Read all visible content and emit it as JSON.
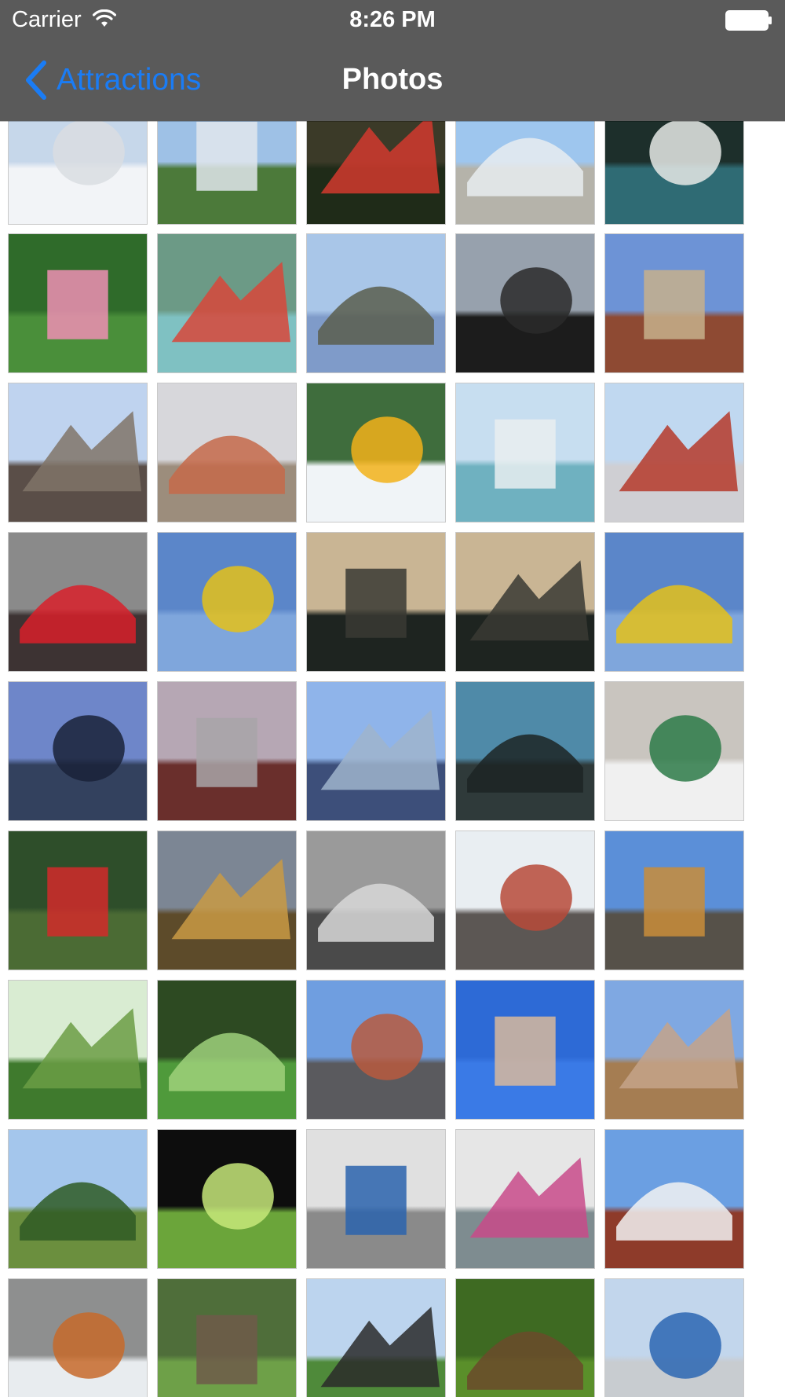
{
  "status_bar": {
    "carrier": "Carrier",
    "time": "8:26 PM",
    "wifi_icon": "wifi-icon",
    "battery_icon": "battery-icon"
  },
  "nav_bar": {
    "back_label": "Attractions",
    "back_icon": "chevron-left-icon",
    "title": "Photos",
    "back_color": "#1a7cf5",
    "background": "#5a5a5a"
  },
  "grid": {
    "columns": 5,
    "photos": [
      {
        "name": "snowy-dome",
        "sky": "#c6d7ea",
        "ground": "#f2f4f7",
        "accent": "#d9dde2"
      },
      {
        "name": "biosphere-dome",
        "sky": "#9ec1e6",
        "ground": "#4c7a3a",
        "accent": "#e0e6ec"
      },
      {
        "name": "red-flowers",
        "sky": "#3b3a28",
        "ground": "#1f2b18",
        "accent": "#d23a2e"
      },
      {
        "name": "stadium-roof",
        "sky": "#9ec6ee",
        "ground": "#b5b3aa",
        "accent": "#e8ecf0"
      },
      {
        "name": "pond-stones",
        "sky": "#1d2f2b",
        "ground": "#2f6b74",
        "accent": "#e6e9e6"
      },
      {
        "name": "pink-lotus",
        "sky": "#2f6b2a",
        "ground": "#4a8f3a",
        "accent": "#ef8fb4"
      },
      {
        "name": "lantern-garden",
        "sky": "#6c9a86",
        "ground": "#7fc1c2",
        "accent": "#d8463a"
      },
      {
        "name": "canal-bridge",
        "sky": "#a9c6e8",
        "ground": "#7f9bc9",
        "accent": "#5a5e4d"
      },
      {
        "name": "statue-silhouette",
        "sky": "#97a1ad",
        "ground": "#1c1c1c",
        "accent": "#2a2a2a"
      },
      {
        "name": "brick-building",
        "sky": "#6d93d6",
        "ground": "#8e4a33",
        "accent": "#c7b08c"
      },
      {
        "name": "old-city-towers",
        "sky": "#bfd3ef",
        "ground": "#5a4e48",
        "accent": "#807468"
      },
      {
        "name": "busy-street",
        "sky": "#d7d7db",
        "ground": "#9c8d7c",
        "accent": "#c56a4a"
      },
      {
        "name": "tour-boat",
        "sky": "#3f6d3d",
        "ground": "#f0f4f7",
        "accent": "#f2b21a"
      },
      {
        "name": "river-cruise",
        "sky": "#c7def0",
        "ground": "#6fb1c0",
        "accent": "#e9eef0"
      },
      {
        "name": "chinatown-gate",
        "sky": "#c0d8f0",
        "ground": "#cfcfd3",
        "accent": "#b53a2a"
      },
      {
        "name": "market-lantern",
        "sky": "#8a8a8a",
        "ground": "#3d3333",
        "accent": "#d8202a"
      },
      {
        "name": "coaster-loop",
        "sky": "#5b86c9",
        "ground": "#7fa6dc",
        "accent": "#e5c119"
      },
      {
        "name": "bridge-sunset",
        "sky": "#c9b594",
        "ground": "#1e2420",
        "accent": "#3a3a34"
      },
      {
        "name": "bridge-sunset-2",
        "sky": "#c9b594",
        "ground": "#1e2420",
        "accent": "#3a3a34"
      },
      {
        "name": "coaster-loop-2",
        "sky": "#5b86c9",
        "ground": "#7fa6dc",
        "accent": "#e5c119"
      },
      {
        "name": "glass-tower",
        "sky": "#6e86c9",
        "ground": "#33415e",
        "accent": "#1a2238"
      },
      {
        "name": "skyline-dusk",
        "sky": "#b6a7b4",
        "ground": "#6a2f2c",
        "accent": "#a8a4a8"
      },
      {
        "name": "angled-skyscraper",
        "sky": "#8fb4ea",
        "ground": "#3d4f7a",
        "accent": "#9fb4cc"
      },
      {
        "name": "harbor-ship",
        "sky": "#4f8aa8",
        "ground": "#2f3a3a",
        "accent": "#1c2524"
      },
      {
        "name": "stone-facade",
        "sky": "#c9c5bf",
        "ground": "#f0f0f0",
        "accent": "#2d7a48"
      },
      {
        "name": "mounties",
        "sky": "#2e4e2a",
        "ground": "#4b6b34",
        "accent": "#d22a2a"
      },
      {
        "name": "autumn-church",
        "sky": "#7c8694",
        "ground": "#5d4b2a",
        "accent": "#c99a44"
      },
      {
        "name": "bw-street",
        "sky": "#9a9a9a",
        "ground": "#4a4a4a",
        "accent": "#d8d8d8"
      },
      {
        "name": "row-houses",
        "sky": "#e9eef2",
        "ground": "#5c5754",
        "accent": "#b74a3a"
      },
      {
        "name": "park-fountain",
        "sky": "#5b8fd8",
        "ground": "#565149",
        "accent": "#c98d3a"
      },
      {
        "name": "park-pavilion",
        "sky": "#d9ecd2",
        "ground": "#3f7a2d",
        "accent": "#6b9e45"
      },
      {
        "name": "garden-fountain",
        "sky": "#2d4a22",
        "ground": "#4f9a3b",
        "accent": "#9fd17b"
      },
      {
        "name": "boulevard",
        "sky": "#6f9ee0",
        "ground": "#5a5a5e",
        "accent": "#b85a3e"
      },
      {
        "name": "clock-tower-tilt",
        "sky": "#2d6ad6",
        "ground": "#3a7ae6",
        "accent": "#d8b89c"
      },
      {
        "name": "clock-tower",
        "sky": "#7fa8e2",
        "ground": "#a57d52",
        "accent": "#c4a38a"
      },
      {
        "name": "tree-lined-field",
        "sky": "#a4c6ec",
        "ground": "#6b8f3e",
        "accent": "#2f5a24"
      },
      {
        "name": "forest-window",
        "sky": "#0d0d0d",
        "ground": "#6ba53a",
        "accent": "#c7e87a"
      },
      {
        "name": "metro-station",
        "sky": "#e0e0e0",
        "ground": "#8a8a8a",
        "accent": "#2a63ad"
      },
      {
        "name": "painted-facade",
        "sky": "#e6e6e6",
        "ground": "#7e8c90",
        "accent": "#c84a8a"
      },
      {
        "name": "historic-hotel",
        "sky": "#6b9fe2",
        "ground": "#8e3b2a",
        "accent": "#f2f2f2"
      },
      {
        "name": "snow-tiger",
        "sky": "#8e8f8f",
        "ground": "#e8ecef",
        "accent": "#c76a2a"
      },
      {
        "name": "tortoise-hut",
        "sky": "#4f6e3a",
        "ground": "#6ea048",
        "accent": "#6f5a4a"
      },
      {
        "name": "zebra-pavilion",
        "sky": "#bcd4ee",
        "ground": "#4f8a3a",
        "accent": "#2a2a2a"
      },
      {
        "name": "monkeys-grass",
        "sky": "#3e6a22",
        "ground": "#5a8f2a",
        "accent": "#6b4a2a"
      },
      {
        "name": "street-sign",
        "sky": "#c2d6ec",
        "ground": "#c8ccd0",
        "accent": "#2c66b3"
      }
    ]
  }
}
